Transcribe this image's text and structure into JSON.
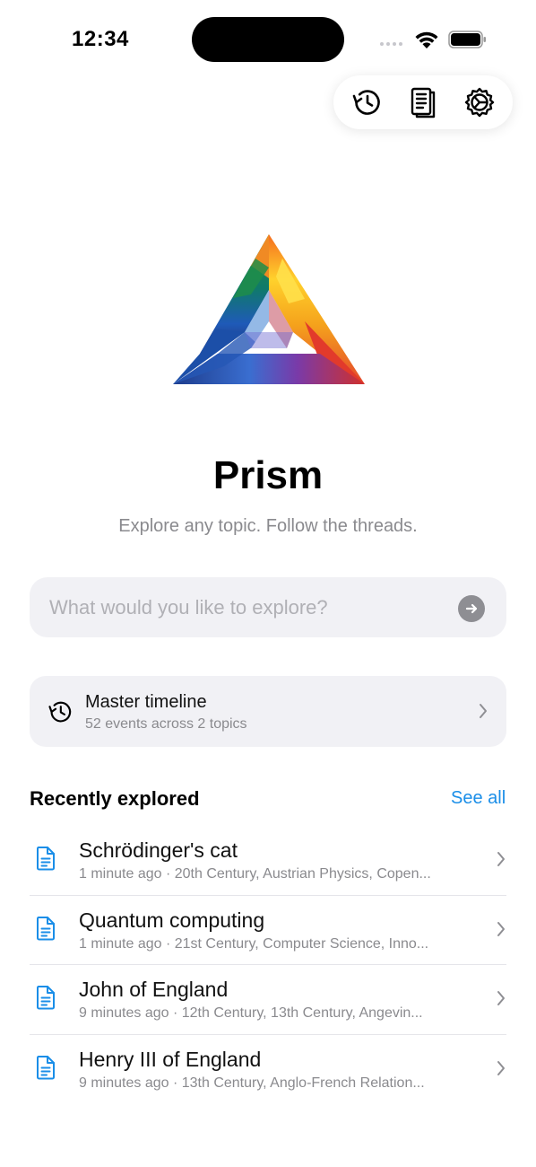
{
  "status": {
    "time": "12:34"
  },
  "toolbar": {
    "icons": [
      "history-icon",
      "notebook-icon",
      "settings-icon"
    ]
  },
  "app": {
    "title": "Prism",
    "tagline": "Explore any topic. Follow the threads."
  },
  "search": {
    "placeholder": "What would you like to explore?",
    "value": ""
  },
  "timeline": {
    "title": "Master timeline",
    "subtitle": "52 events across 2 topics"
  },
  "recent": {
    "title": "Recently explored",
    "see_all": "See all",
    "items": [
      {
        "title": "Schrödinger's cat",
        "meta": "1 minute ago · 20th Century, Austrian Physics, Copen..."
      },
      {
        "title": "Quantum computing",
        "meta": "1 minute ago · 21st Century, Computer Science, Inno..."
      },
      {
        "title": "John of England",
        "meta": "9 minutes ago · 12th Century, 13th Century, Angevin..."
      },
      {
        "title": "Henry III of England",
        "meta": "9 minutes ago · 13th Century, Anglo-French Relation..."
      }
    ]
  },
  "colors": {
    "accent": "#1a8ee8",
    "card": "#f1f1f5",
    "secondary_text": "#8a8a8e"
  }
}
